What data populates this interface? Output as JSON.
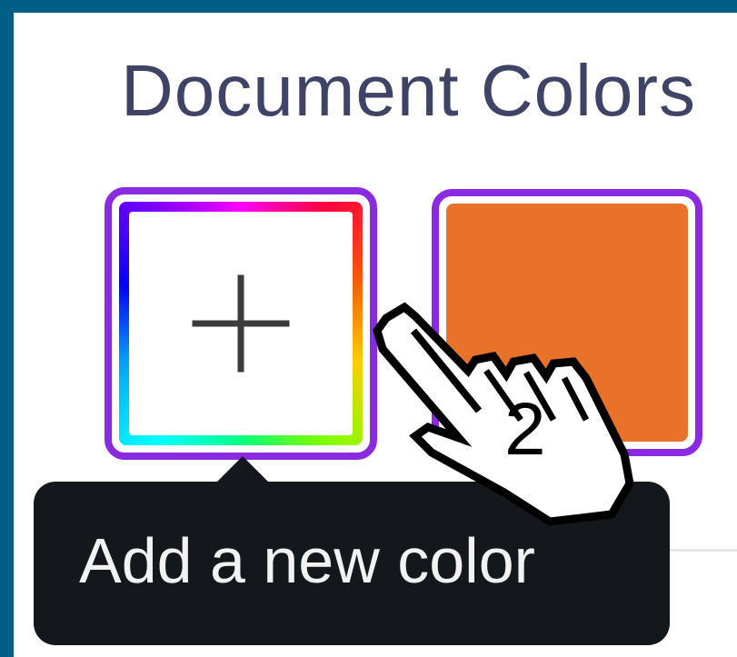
{
  "section": {
    "title": "Document Colors"
  },
  "add_color": {
    "icon": "plus-icon"
  },
  "document_colors": [
    {
      "hex": "#e8722a"
    }
  ],
  "accent": "#8a2be2",
  "tooltip": {
    "text": "Add a new color"
  },
  "annotation": {
    "step": "2",
    "icon": "hand-pointer-icon"
  }
}
